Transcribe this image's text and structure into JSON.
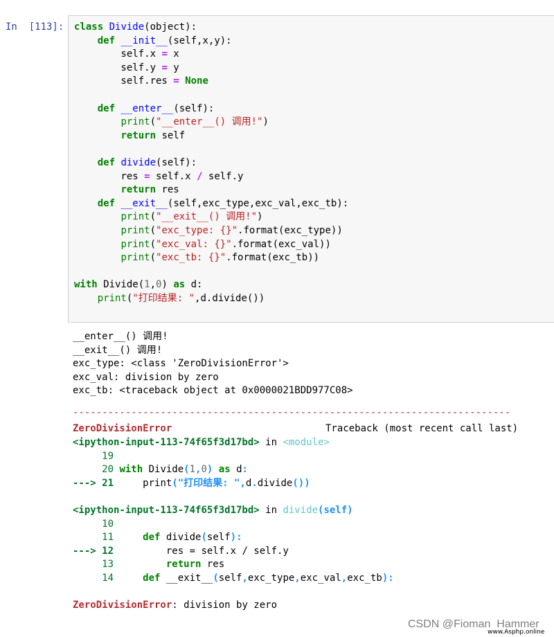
{
  "cell": {
    "prompt": "In  [113]:",
    "code": {
      "l1": [
        "class",
        " ",
        "Divide",
        "(object):"
      ],
      "l2": [
        "    ",
        "def",
        " ",
        "__init__",
        "(self,x,y):"
      ],
      "l3": [
        "        self.x ",
        "=",
        " x"
      ],
      "l4": [
        "        self.y ",
        "=",
        " y"
      ],
      "l5": [
        "        self.res ",
        "=",
        " ",
        "None"
      ],
      "l7": [
        "    ",
        "def",
        " ",
        "__enter__",
        "(self):"
      ],
      "l8": [
        "        ",
        "print",
        "(",
        "\"__enter__() 调用!\"",
        ")"
      ],
      "l9": [
        "        ",
        "return",
        " self"
      ],
      "l11": [
        "    ",
        "def",
        " ",
        "divide",
        "(self):"
      ],
      "l12": [
        "        res ",
        "=",
        " self.x ",
        "/",
        " self.y"
      ],
      "l13": [
        "        ",
        "return",
        " res"
      ],
      "l14": [
        "    ",
        "def",
        " ",
        "__exit__",
        "(self,exc_type,exc_val,exc_tb):"
      ],
      "l15": [
        "        ",
        "print",
        "(",
        "\"__exit__() 调用!\"",
        ")"
      ],
      "l16": [
        "        ",
        "print",
        "(",
        "\"exc_type: {}\"",
        ".format(exc_type))"
      ],
      "l17": [
        "        ",
        "print",
        "(",
        "\"exc_val: {}\"",
        ".format(exc_val))"
      ],
      "l18": [
        "        ",
        "print",
        "(",
        "\"exc_tb: {}\"",
        ".format(exc_tb))"
      ],
      "l20": [
        "with",
        " Divide(",
        "1",
        ",",
        "0",
        ") ",
        "as",
        " d:"
      ],
      "l21": [
        "    ",
        "print",
        "(",
        "\"打印结果: \"",
        ",d.divide())"
      ]
    }
  },
  "output": {
    "stdout": [
      "__enter__() 调用!",
      "__exit__() 调用!",
      "exc_type: <class 'ZeroDivisionError'>",
      "exc_val: division by zero",
      "exc_tb: <traceback object at 0x0000021BDD977C08>"
    ],
    "separator": "---------------------------------------------------------------------------",
    "error_name": "ZeroDivisionError",
    "traceback_header": "Traceback (most recent call last)",
    "frame1": {
      "file": "<ipython-input-113-74f65f3d17bd>",
      "in_word": " in ",
      "location": "<module>",
      "l19": "     19",
      "l20_no": "     20 ",
      "l20": [
        "with",
        " Divide",
        "(",
        "1",
        ",",
        "0",
        ")",
        " ",
        "as",
        " d",
        ":"
      ],
      "arrow": "---> 21",
      "l21": [
        "     print",
        "(",
        "\"打印结果: \"",
        ",",
        "d",
        ".",
        "divide",
        "(",
        ")",
        ")"
      ]
    },
    "frame2": {
      "file": "<ipython-input-113-74f65f3d17bd>",
      "in_word": " in ",
      "location": "divide",
      "location_args": "(self)",
      "l10": "     10",
      "l11_no": "     11     ",
      "l11": [
        "def",
        " divide",
        "(",
        "self",
        ")",
        ":"
      ],
      "arrow": "---> 12",
      "l12": "         res = self.x / self.y",
      "l13_no": "     13         ",
      "l13": [
        "return",
        " res"
      ],
      "l14_no": "     14     ",
      "l14": [
        "def",
        " __exit__",
        "(",
        "self",
        ",",
        "exc_type",
        ",",
        "exc_val",
        ",",
        "exc_tb",
        ")",
        ":"
      ]
    },
    "final_error_name": "ZeroDivisionError",
    "final_error_msg": ": division by zero"
  },
  "watermark": {
    "text": "CSDN @Fioman_Hammer",
    "domain": "www.Asphp.online"
  }
}
